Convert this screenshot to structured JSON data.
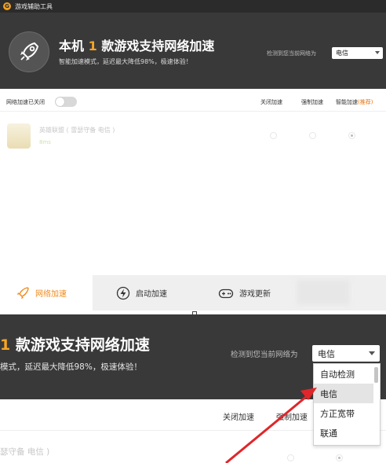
{
  "app": {
    "title": "游戏辅助工具",
    "logo_letter": "G",
    "accent": "#f5a623"
  },
  "banner": {
    "title_prefix": "本机",
    "title_count": "1",
    "title_suffix": "款游戏支持网络加速",
    "subtitle": "智能加速模式，延迟最大降低98%，极速体验！",
    "network_label": "检测到您当前网络为",
    "network_value": "电信"
  },
  "toolbar": {
    "toggle_label": "网络加速已关闭",
    "toggle_on": false,
    "col_off": "关闭加速",
    "col_force": "强制加速",
    "col_smart": "智能加速",
    "col_smart_tag": "(推荐)"
  },
  "game": {
    "name": "英雄联盟 ( 雷瑟守备 电信 )",
    "status": "8ms"
  },
  "nav": {
    "items": [
      {
        "label": "网络加速",
        "icon": "rocket-icon",
        "active": true
      },
      {
        "label": "启动加速",
        "icon": "lightning-icon",
        "active": false
      },
      {
        "label": "游戏更新",
        "icon": "gamepad-icon",
        "active": false
      }
    ]
  },
  "zoom": {
    "title_count": "1",
    "title_text": "款游戏支持网络加速",
    "subtitle": "模式，延迟最大降低98%，极速体验！",
    "network_label": "检测到您当前网络为",
    "network_value": "电信",
    "col_off": "关闭加速",
    "col_force": "强制加速",
    "game_partial": "瑟守备 电信 )",
    "dropdown_options": [
      "自动检测",
      "电信",
      "方正宽带",
      "联通"
    ],
    "dropdown_selected_index": 1
  }
}
